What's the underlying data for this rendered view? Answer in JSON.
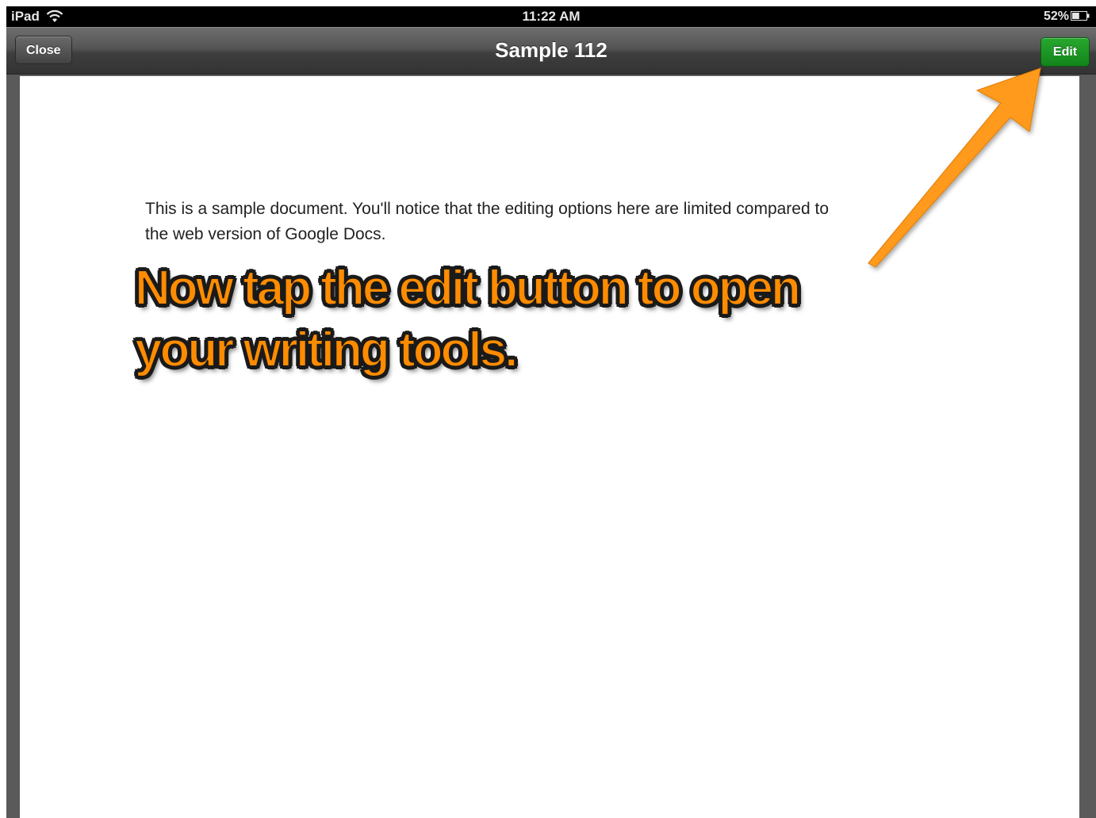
{
  "status_bar": {
    "device": "iPad",
    "time": "11:22 AM",
    "battery_percent": "52%",
    "battery_level": 0.52,
    "icons": [
      "wifi-icon",
      "battery-icon"
    ]
  },
  "nav_bar": {
    "title": "Sample 112",
    "close_label": "Close",
    "edit_label": "Edit",
    "edit_color": "#1a9623"
  },
  "document": {
    "line_1": "This is a sample document. You'll notice that the editing options here are limited compared to",
    "line_2": "the web version of Google Docs."
  },
  "annotation": {
    "line_1": "Now tap the edit button to open",
    "line_2": "your writing tools.",
    "color": "#ff8c00",
    "arrow_icon": "arrow-icon"
  }
}
